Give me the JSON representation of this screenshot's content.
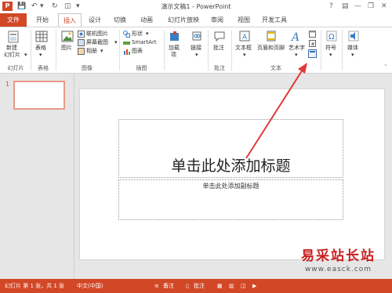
{
  "titlebar": {
    "app_logo": "P",
    "title": "演示文稿1 - PowerPoint",
    "help": "?",
    "minimize": "—",
    "restore": "❐",
    "close": "✕"
  },
  "tabs": [
    "文件",
    "开始",
    "插入",
    "设计",
    "切换",
    "动画",
    "幻灯片放映",
    "审阅",
    "视图",
    "开发工具"
  ],
  "ribbon": {
    "groups": {
      "slides": "幻灯片",
      "tables": "表格",
      "images": "图像",
      "illustrations": "插图",
      "comments": "批注",
      "text": "文本"
    },
    "new_slide": [
      "新建",
      "幻灯片"
    ],
    "table": "表格",
    "picture": "图片",
    "online_picture": "联机图片",
    "screenshot": "屏幕截图",
    "album": "相册",
    "shapes": "形状",
    "smartart": "SmartArt",
    "chart": "图表",
    "addins": [
      "加载",
      "项"
    ],
    "links": "链接",
    "comment": "批注",
    "textbox": "文本框",
    "header_footer": "页眉和页脚",
    "wordart": "艺术字",
    "symbol": "符号",
    "media": "媒体"
  },
  "thumbnail": {
    "number": "1"
  },
  "slide": {
    "title_placeholder": "单击此处添加标题",
    "subtitle_placeholder": "单击此处添加副标题"
  },
  "statusbar": {
    "slide_info": "幻灯片 第 1 张，共 1 张",
    "language": "中文(中国)",
    "notes": "备注",
    "comments": "批注"
  },
  "watermark": {
    "text": "易采站长站",
    "url": "www.easck.com"
  },
  "colors": {
    "accent": "#d24726",
    "arrow": "#e03a3a"
  }
}
